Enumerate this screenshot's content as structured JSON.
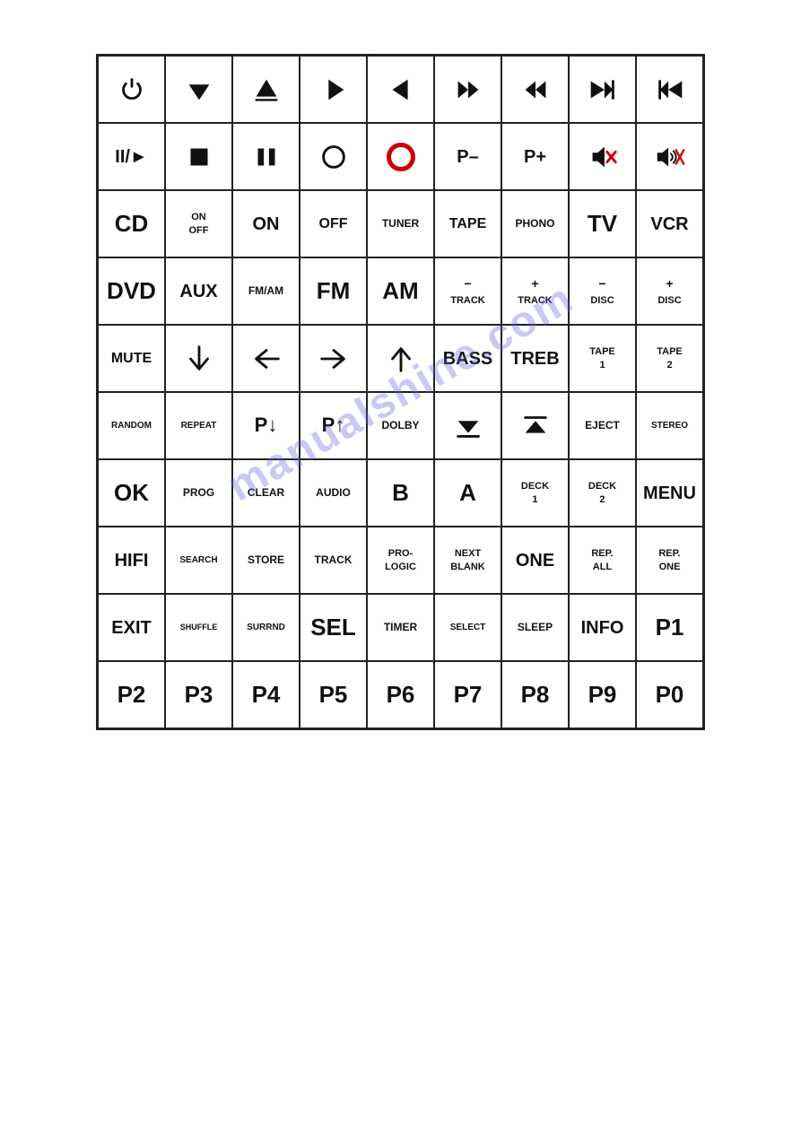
{
  "grid": {
    "rows": 10,
    "cols": 9,
    "cells": [
      {
        "type": "svg-power",
        "label": ""
      },
      {
        "type": "svg-vol-down",
        "label": ""
      },
      {
        "type": "svg-vol-up",
        "label": ""
      },
      {
        "type": "svg-play",
        "label": ""
      },
      {
        "type": "svg-prev",
        "label": ""
      },
      {
        "type": "svg-ff",
        "label": ""
      },
      {
        "type": "svg-rew",
        "label": ""
      },
      {
        "type": "svg-next",
        "label": ""
      },
      {
        "type": "svg-skipback",
        "label": ""
      },
      {
        "type": "svg-playpause",
        "label": ""
      },
      {
        "type": "svg-stop-sq",
        "label": ""
      },
      {
        "type": "svg-pause",
        "label": ""
      },
      {
        "type": "svg-record-open",
        "label": ""
      },
      {
        "type": "red-circle",
        "label": ""
      },
      {
        "type": "text",
        "label": "P–",
        "size": "lg"
      },
      {
        "type": "text",
        "label": "P+",
        "size": "lg"
      },
      {
        "type": "svg-mute1",
        "label": ""
      },
      {
        "type": "svg-mute2",
        "label": ""
      },
      {
        "type": "text",
        "label": "CD",
        "size": "xl"
      },
      {
        "type": "text-sm",
        "label": "ON\nOFF"
      },
      {
        "type": "text",
        "label": "ON",
        "size": "lg"
      },
      {
        "type": "text",
        "label": "OFF",
        "size": "md"
      },
      {
        "type": "text",
        "label": "TUNER",
        "size": "sm"
      },
      {
        "type": "text",
        "label": "TAPE",
        "size": "md"
      },
      {
        "type": "text",
        "label": "PHONO",
        "size": "sm"
      },
      {
        "type": "text",
        "label": "TV",
        "size": "xl"
      },
      {
        "type": "text",
        "label": "VCR",
        "size": "lg"
      },
      {
        "type": "text",
        "label": "DVD",
        "size": "xl"
      },
      {
        "type": "text",
        "label": "AUX",
        "size": "lg"
      },
      {
        "type": "text",
        "label": "FM/AM",
        "size": "sm"
      },
      {
        "type": "text",
        "label": "FM",
        "size": "xl"
      },
      {
        "type": "text",
        "label": "AM",
        "size": "xl"
      },
      {
        "type": "track-minus",
        "label": ""
      },
      {
        "type": "track-plus",
        "label": ""
      },
      {
        "type": "disc-minus",
        "label": ""
      },
      {
        "type": "disc-plus",
        "label": ""
      },
      {
        "type": "text",
        "label": "MUTE",
        "size": "md"
      },
      {
        "type": "svg-arrow-down",
        "label": ""
      },
      {
        "type": "svg-arrow-left",
        "label": ""
      },
      {
        "type": "svg-arrow-right",
        "label": ""
      },
      {
        "type": "svg-arrow-up",
        "label": ""
      },
      {
        "type": "text",
        "label": "BASS",
        "size": "lg"
      },
      {
        "type": "text",
        "label": "TREB",
        "size": "lg"
      },
      {
        "type": "text-tape1",
        "label": ""
      },
      {
        "type": "text-tape2",
        "label": ""
      },
      {
        "type": "text",
        "label": "RANDOM",
        "size": "xs"
      },
      {
        "type": "text",
        "label": "REPEAT",
        "size": "xs"
      },
      {
        "type": "text-pdown",
        "label": ""
      },
      {
        "type": "text-pup",
        "label": ""
      },
      {
        "type": "text",
        "label": "DOLBY",
        "size": "sm"
      },
      {
        "type": "svg-eject-down",
        "label": ""
      },
      {
        "type": "svg-eject-up",
        "label": ""
      },
      {
        "type": "text",
        "label": "EJECT",
        "size": "sm"
      },
      {
        "type": "text",
        "label": "STEREO",
        "size": "xs"
      },
      {
        "type": "text",
        "label": "OK",
        "size": "xl"
      },
      {
        "type": "text",
        "label": "PROG",
        "size": "sm"
      },
      {
        "type": "text",
        "label": "CLEAR",
        "size": "sm"
      },
      {
        "type": "text",
        "label": "AUDIO",
        "size": "sm"
      },
      {
        "type": "text",
        "label": "B",
        "size": "xl"
      },
      {
        "type": "text",
        "label": "A",
        "size": "xl"
      },
      {
        "type": "text-deck1",
        "label": ""
      },
      {
        "type": "text-deck2",
        "label": ""
      },
      {
        "type": "text",
        "label": "MENU",
        "size": "lg"
      },
      {
        "type": "text",
        "label": "HIFI",
        "size": "lg"
      },
      {
        "type": "text",
        "label": "SEARCH",
        "size": "xs"
      },
      {
        "type": "text",
        "label": "STORE",
        "size": "sm"
      },
      {
        "type": "text",
        "label": "TRACK",
        "size": "sm"
      },
      {
        "type": "text-prologic",
        "label": ""
      },
      {
        "type": "text-nextblank",
        "label": ""
      },
      {
        "type": "text",
        "label": "ONE",
        "size": "lg"
      },
      {
        "type": "text-repall",
        "label": ""
      },
      {
        "type": "text-repone",
        "label": ""
      },
      {
        "type": "text",
        "label": "EXIT",
        "size": "lg"
      },
      {
        "type": "text",
        "label": "SHUFFLE",
        "size": "xxs"
      },
      {
        "type": "text",
        "label": "SURRND",
        "size": "xs"
      },
      {
        "type": "text",
        "label": "SEL",
        "size": "xl"
      },
      {
        "type": "text",
        "label": "TIMER",
        "size": "sm"
      },
      {
        "type": "text",
        "label": "SELECT",
        "size": "xs"
      },
      {
        "type": "text",
        "label": "SLEEP",
        "size": "sm"
      },
      {
        "type": "text",
        "label": "INFO",
        "size": "lg"
      },
      {
        "type": "text",
        "label": "P1",
        "size": "xl"
      },
      {
        "type": "text",
        "label": "P2",
        "size": "xl"
      },
      {
        "type": "text",
        "label": "P3",
        "size": "xl"
      },
      {
        "type": "text",
        "label": "P4",
        "size": "xl"
      },
      {
        "type": "text",
        "label": "P5",
        "size": "xl"
      },
      {
        "type": "text",
        "label": "P6",
        "size": "xl"
      },
      {
        "type": "text",
        "label": "P7",
        "size": "xl"
      },
      {
        "type": "text",
        "label": "P8",
        "size": "xl"
      },
      {
        "type": "text",
        "label": "P9",
        "size": "xl"
      },
      {
        "type": "text",
        "label": "P0",
        "size": "xl"
      }
    ]
  }
}
